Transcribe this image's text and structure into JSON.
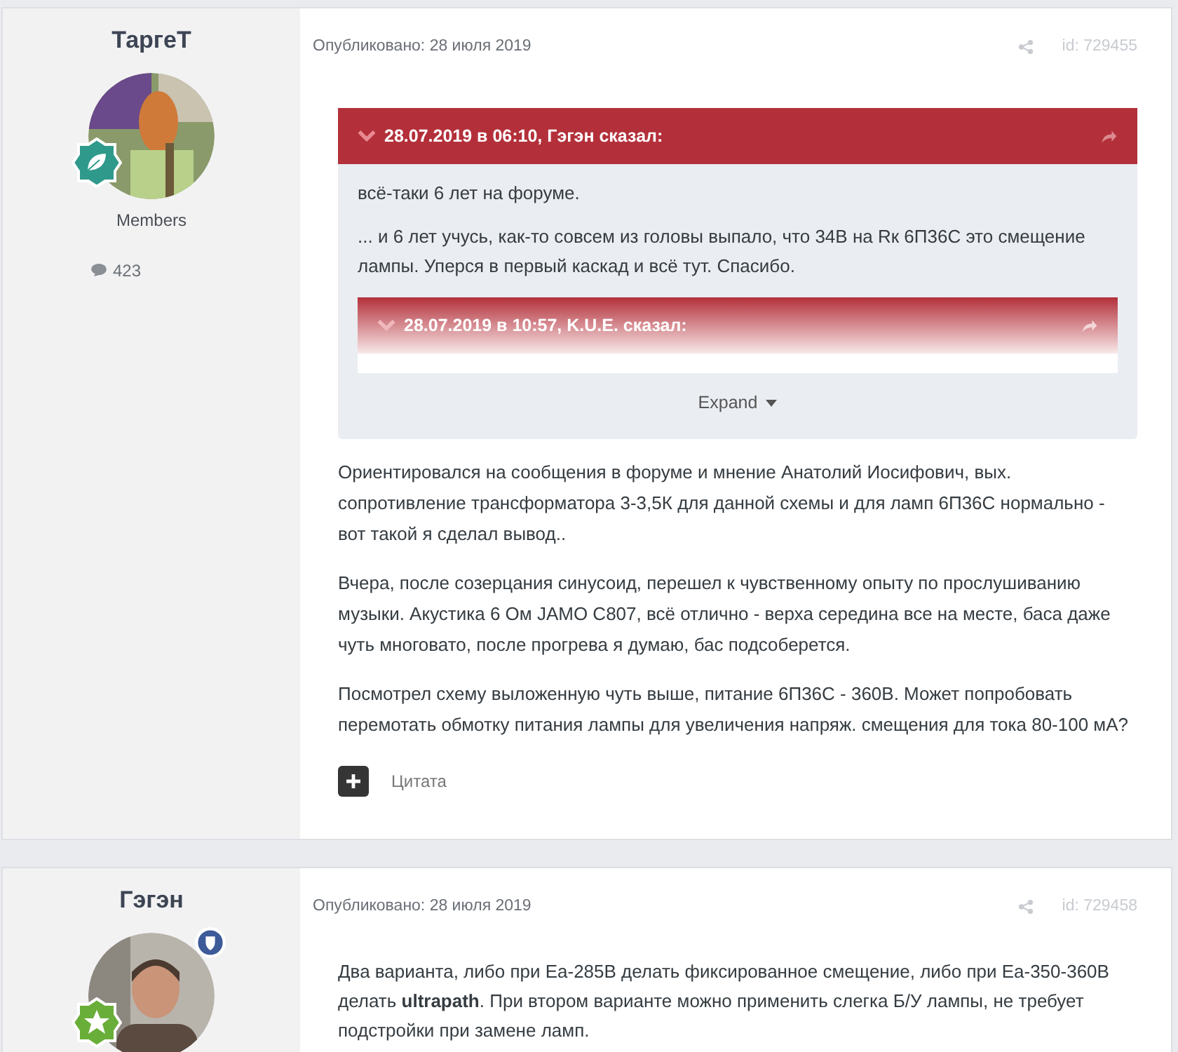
{
  "posts": [
    {
      "author": {
        "name": "ТаргеТ",
        "group": "Members",
        "post_count": "423",
        "badge": {
          "kind": "leaf"
        },
        "moderator": false
      },
      "published": "Опубликовано: 28 июля 2019",
      "post_id": "id: 729455",
      "quote": {
        "header": "28.07.2019 в 06:10, Гэгэн сказал:",
        "paragraphs": [
          "всё-таки 6 лет на форуме.",
          "... и 6 лет учусь, как-то совсем из головы выпало, что 34В на Rк 6П36С это смещение лампы. Уперся в первый каскад и всё тут. Спасибо."
        ],
        "nested_header": "28.07.2019 в 10:57, K.U.E. сказал:",
        "expand": "Expand"
      },
      "paragraphs": [
        "Ориентировался на сообщения в форуме и мнение Анатолий Иосифович, вых. сопротивление трансформатора 3-3,5К для данной схемы и для ламп 6П36С нормально - вот такой я сделал вывод..",
        "Вчера, после созерцания синусоид, перешел к чувственному опыту по прослушиванию музыки. Акустика 6 Ом JAMO C807, всё отлично - верха середина все на месте, баса даже чуть многовато, после прогрева я думаю, бас подсоберется.",
        "Посмотрел схему выложенную чуть выше, питание 6П36С - 360В. Может попробовать перемотать обмотку питания лампы для увеличения напряж. смещения для тока 80-100 мА?"
      ],
      "quote_action": "Цитата"
    },
    {
      "author": {
        "name": "Гэгэн",
        "badge": {
          "kind": "star"
        },
        "moderator": true
      },
      "published": "Опубликовано: 28 июля 2019",
      "post_id": "id: 729458",
      "paragraphs": [
        "Два варианта, либо при Еа-285В делать фиксированное смещение, либо при Еа-350-360В делать  **ultrapath**. При втором варианте можно применить слегка Б/У лампы, не требует подстройки при замене ламп."
      ]
    }
  ]
}
